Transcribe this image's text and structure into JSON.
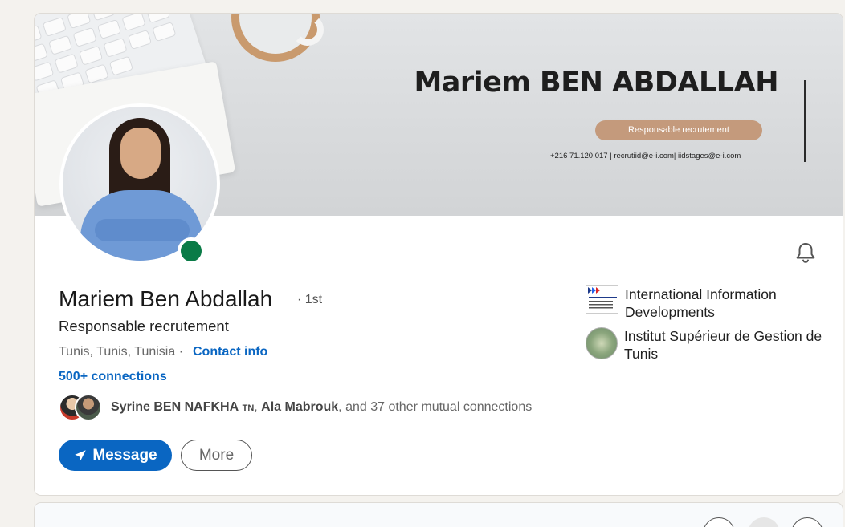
{
  "banner": {
    "name": "Mariem BEN ABDALLAH",
    "role": "Responsable recrutement",
    "contact": "+216 71.120.017  |  recrutiid@e-i.com| iidstages@e-i.com"
  },
  "profile": {
    "name": "Mariem Ben Abdallah",
    "degree": "· 1st",
    "headline": "Responsable recrutement",
    "location": "Tunis, Tunis, Tunisia ·",
    "contact_info": "Contact info",
    "connections": "500+ connections",
    "status_color": "#0a7b47"
  },
  "mutual": {
    "name1": "Syrine BEN NAFKHA",
    "name1_tag": "TN",
    "sep1": ", ",
    "name2": "Ala Mabrouk",
    "rest": ", and 37 other mutual connections"
  },
  "actions": {
    "message_label": "Message",
    "more_label": "More"
  },
  "orgs": [
    {
      "name": "International Information Developments",
      "logo_text": "INTERNATIONAL INFORMATION DEVELOPMENTS"
    },
    {
      "name": "Institut Supérieur de Gestion de Tunis"
    }
  ],
  "icons": {
    "notification": "bell-icon",
    "message": "paper-plane-icon"
  },
  "colors": {
    "accent": "#0a66c2",
    "banner_pill": "#c49a7c"
  }
}
